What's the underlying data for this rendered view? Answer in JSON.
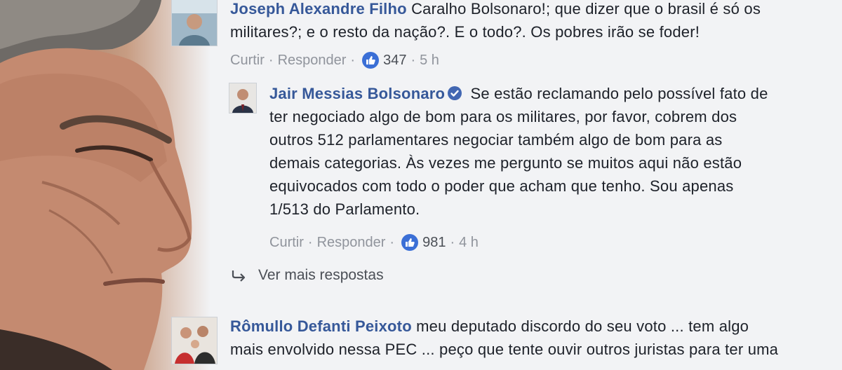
{
  "comments": [
    {
      "author": "Joseph Alexandre Filho",
      "text_line1": "Caralho Bolsonaro!; que dizer que o brasil é só os",
      "text_line2": "militares?; e o resto da nação?. E o todo?. Os pobres irão se foder!",
      "like_label": "Curtir",
      "reply_label": "Responder",
      "likes": "347",
      "time": "5 h",
      "avatar_icon": "profile-photo-icon"
    },
    {
      "author": "Jair Messias Bolsonaro",
      "verified_icon": "verified-check-icon",
      "lines": [
        "Se estão reclamando pelo possível fato de",
        "ter negociado algo de bom para os militares, por favor, cobrem dos",
        "outros 512 parlamentares negociar também algo de bom para as",
        "demais categorias. Às vezes me pergunto se muitos aqui não estão",
        "equivocados com todo o poder que acham que tenho. Sou apenas",
        "1/513 do Parlamento."
      ],
      "like_label": "Curtir",
      "reply_label": "Responder",
      "likes": "981",
      "time": "4 h",
      "avatar_icon": "profile-photo-icon"
    },
    {
      "author": "Rômullo Defanti Peixoto",
      "text_line1": "meu deputado discordo do seu voto ... tem algo",
      "text_line2": "mais envolvido nessa PEC ... peço que tente ouvir outros juristas para ter uma",
      "avatar_icon": "profile-photo-icon"
    }
  ],
  "more_replies_label": "Ver mais respostas",
  "colors": {
    "author": "#365899",
    "meta": "#90949c",
    "like_badge": "#3b6fd6",
    "background": "#f2f3f5"
  }
}
